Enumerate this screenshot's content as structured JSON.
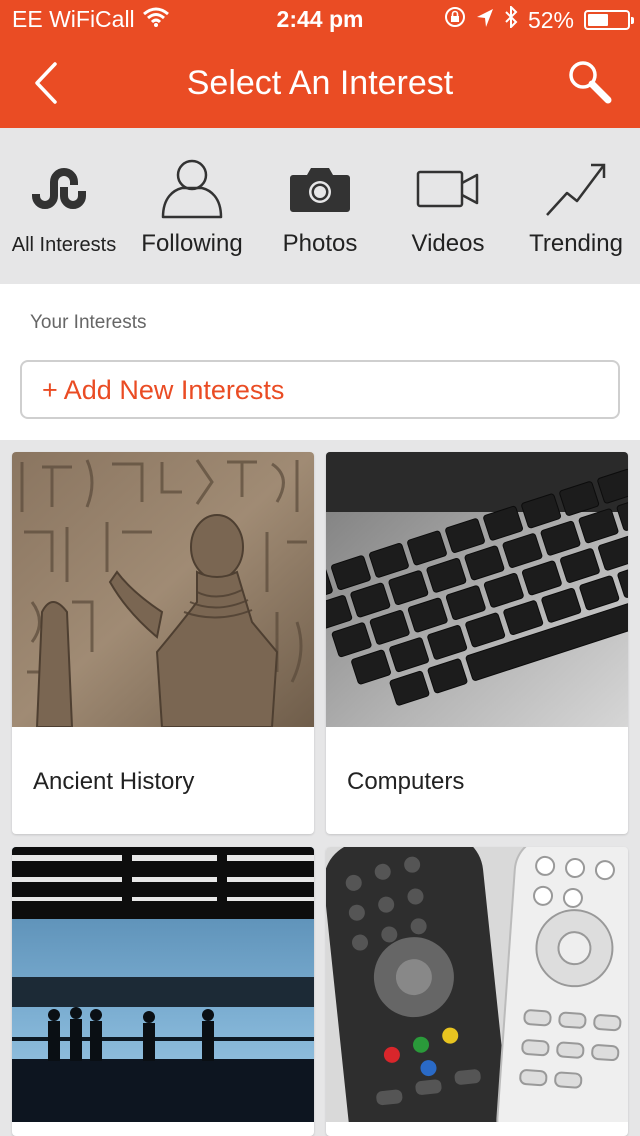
{
  "status_bar": {
    "carrier": "EE WiFiCall",
    "time": "2:44 pm",
    "battery_percent": "52%",
    "battery_level": 0.52
  },
  "nav": {
    "title": "Select An Interest",
    "back_icon": "chevron-left-icon",
    "search_icon": "search-icon"
  },
  "tabs": [
    {
      "label": "All Interests",
      "icon": "stumbleupon-logo-icon"
    },
    {
      "label": "Following",
      "icon": "person-icon"
    },
    {
      "label": "Photos",
      "icon": "camera-icon"
    },
    {
      "label": "Videos",
      "icon": "video-camera-icon"
    },
    {
      "label": "Trending",
      "icon": "trending-up-icon"
    }
  ],
  "your_interests": {
    "title": "Your Interests",
    "add_label": "+ Add New Interests"
  },
  "interests": [
    {
      "name": "Ancient History"
    },
    {
      "name": "Computers"
    },
    {
      "name": ""
    },
    {
      "name": ""
    }
  ],
  "colors": {
    "brand": "#ea4c24",
    "background": "#e6e6e7"
  }
}
